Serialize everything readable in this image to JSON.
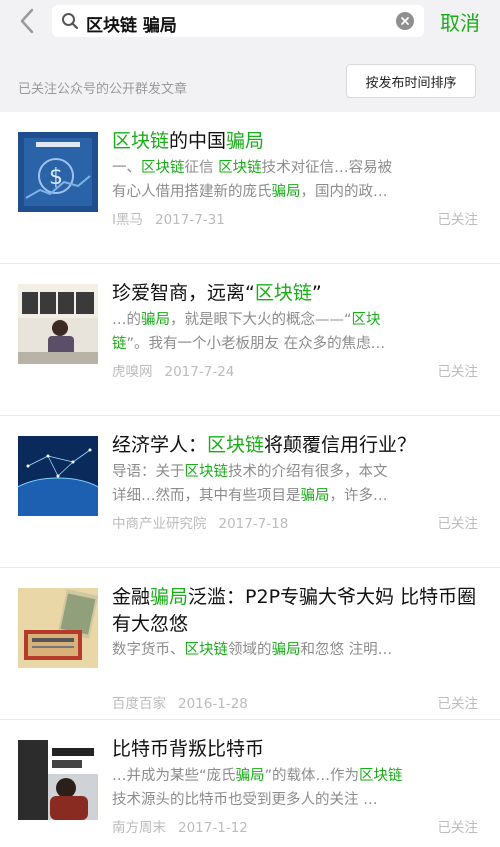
{
  "header": {
    "query_term": "区块链",
    "query_rest": " 骗局",
    "cancel_label": "取消"
  },
  "filter": {
    "label": "已关注公众号的公开群发文章",
    "sort_label": "按发布时间排序"
  },
  "colors": {
    "accent": "#1aad19",
    "background": "#f2f2f4",
    "meta": "#bcbcbc"
  },
  "results": [
    {
      "title": [
        {
          "t": "区块链",
          "hl": true
        },
        {
          "t": "的中国",
          "hl": false
        },
        {
          "t": "骗局",
          "hl": true
        }
      ],
      "snippet_lines": [
        [
          {
            "t": "一、",
            "hl": false
          },
          {
            "t": "区块链",
            "hl": true
          },
          {
            "t": "征信 ",
            "hl": false
          },
          {
            "t": "区块链",
            "hl": true
          },
          {
            "t": "技术对征信…容易被",
            "hl": false
          }
        ],
        [
          {
            "t": "有心人借用搭建新的庞氏",
            "hl": false
          },
          {
            "t": "骗局",
            "hl": true
          },
          {
            "t": "，国内的政…",
            "hl": false
          }
        ]
      ],
      "source": "I黑马",
      "date": "2017-7-31",
      "followed": "已关注",
      "thumb_icon": "dollar-chart-thumbnail"
    },
    {
      "title": [
        {
          "t": "珍爱智商，远离“",
          "hl": false
        },
        {
          "t": "区块链",
          "hl": true
        },
        {
          "t": "”",
          "hl": false
        }
      ],
      "snippet_lines": [
        [
          {
            "t": "…的",
            "hl": false
          },
          {
            "t": "骗局",
            "hl": true
          },
          {
            "t": "，就是眼下大火的概念——“",
            "hl": false
          },
          {
            "t": "区块",
            "hl": true
          }
        ],
        [
          {
            "t": "链",
            "hl": true
          },
          {
            "t": "”。我有一个小老板朋友 在众多的焦虑…",
            "hl": false
          }
        ]
      ],
      "source": "虎嗅网",
      "date": "2017-7-24",
      "followed": "已关注",
      "thumb_icon": "speaker-stage-thumbnail"
    },
    {
      "title": [
        {
          "t": "经济学人：",
          "hl": false
        },
        {
          "t": "区块链",
          "hl": true
        },
        {
          "t": "将颠覆信用行业？",
          "hl": false
        }
      ],
      "snippet_lines": [
        [
          {
            "t": "导语：关于",
            "hl": false
          },
          {
            "t": "区块链",
            "hl": true
          },
          {
            "t": "技术的介绍有很多，本文",
            "hl": false
          }
        ],
        [
          {
            "t": "详细…然而，其中有些项目是",
            "hl": false
          },
          {
            "t": "骗局",
            "hl": true
          },
          {
            "t": "，许多…",
            "hl": false
          }
        ]
      ],
      "source": "中商产业研究院",
      "date": "2017-7-18",
      "followed": "已关注",
      "thumb_icon": "network-globe-thumbnail"
    },
    {
      "title": [
        {
          "t": "金融",
          "hl": false
        },
        {
          "t": "骗局",
          "hl": true
        },
        {
          "t": "泛滥：P2P专骗大爷大妈 比特币圈有大忽悠",
          "hl": false
        }
      ],
      "snippet_lines": [
        [
          {
            "t": "数字货币、",
            "hl": false
          },
          {
            "t": "区块链",
            "hl": true
          },
          {
            "t": "领域的",
            "hl": false
          },
          {
            "t": "骗局",
            "hl": true
          },
          {
            "t": "和忽悠 注明…",
            "hl": false
          }
        ]
      ],
      "source": "百度百家",
      "date": "2016-1-28",
      "followed": "已关注",
      "thumb_icon": "mousetrap-money-thumbnail"
    },
    {
      "title": [
        {
          "t": "比特币背叛比特币",
          "hl": false
        }
      ],
      "snippet_lines": [
        [
          {
            "t": "…并成为某些“庞氏",
            "hl": false
          },
          {
            "t": "骗局",
            "hl": true
          },
          {
            "t": "”的载体…作为",
            "hl": false
          },
          {
            "t": "区块链",
            "hl": true
          }
        ],
        [
          {
            "t": "技术源头的比特币也受到更多人的关注 …",
            "hl": false
          }
        ]
      ],
      "source": "南方周末",
      "date": "2017-1-12",
      "followed": "已关注",
      "thumb_icon": "bitcoin-person-thumbnail"
    }
  ]
}
